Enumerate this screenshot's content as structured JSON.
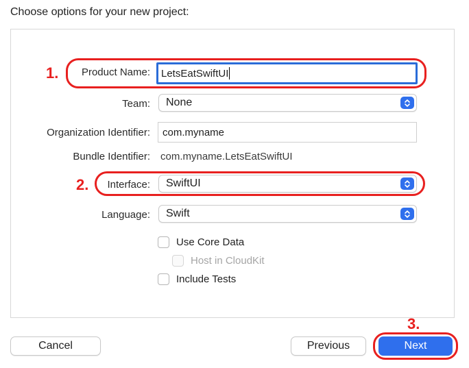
{
  "header": {
    "title": "Choose options for your new project:"
  },
  "form": {
    "product_name": {
      "label": "Product Name:",
      "value": "LetsEatSwiftUI"
    },
    "team": {
      "label": "Team:",
      "value": "None"
    },
    "organization_identifier": {
      "label": "Organization Identifier:",
      "value": "com.myname"
    },
    "bundle_identifier": {
      "label": "Bundle Identifier:",
      "value": "com.myname.LetsEatSwiftUI"
    },
    "interface": {
      "label": "Interface:",
      "value": "SwiftUI"
    },
    "language": {
      "label": "Language:",
      "value": "Swift"
    },
    "options": {
      "use_core_data": {
        "label": "Use Core Data",
        "checked": false
      },
      "host_in_cloudkit": {
        "label": "Host in CloudKit",
        "checked": false,
        "enabled": false
      },
      "include_tests": {
        "label": "Include Tests",
        "checked": false
      }
    }
  },
  "footer": {
    "cancel_label": "Cancel",
    "previous_label": "Previous",
    "next_label": "Next"
  },
  "annotations": {
    "step1": "1.",
    "step2": "2.",
    "step3": "3."
  },
  "colors": {
    "accent": "#2f6fed",
    "annotation_red": "#e8201f",
    "focus_ring": "#2a6cd8"
  },
  "icons": {
    "popup_arrows": "chevron-up-down-icon"
  }
}
